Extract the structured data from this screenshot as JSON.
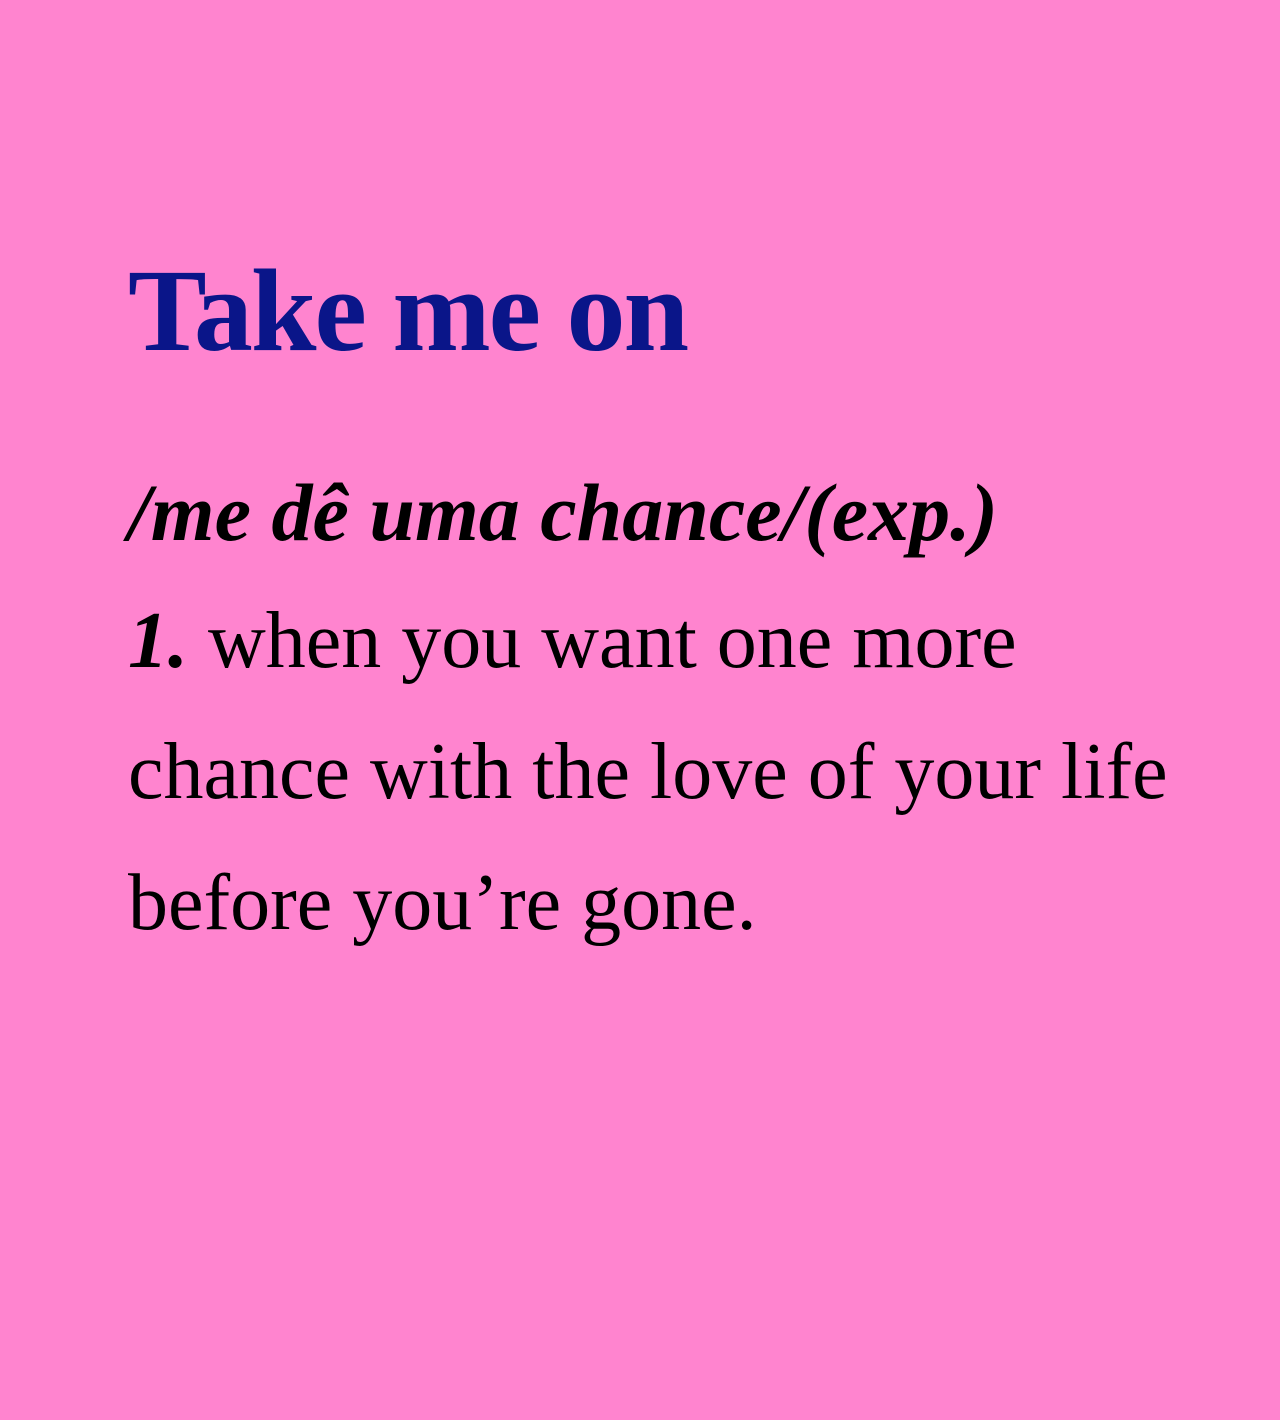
{
  "entry": {
    "headword": "Take me on",
    "pronunciation": "/me dê uma chance/(exp.)",
    "sense_number": "1.",
    "definition": "when you want one more chance with the love of your life before you’re gone.",
    "colors": {
      "background": "#ff84cf",
      "headword": "#0a1589",
      "body_text": "#000000"
    }
  }
}
